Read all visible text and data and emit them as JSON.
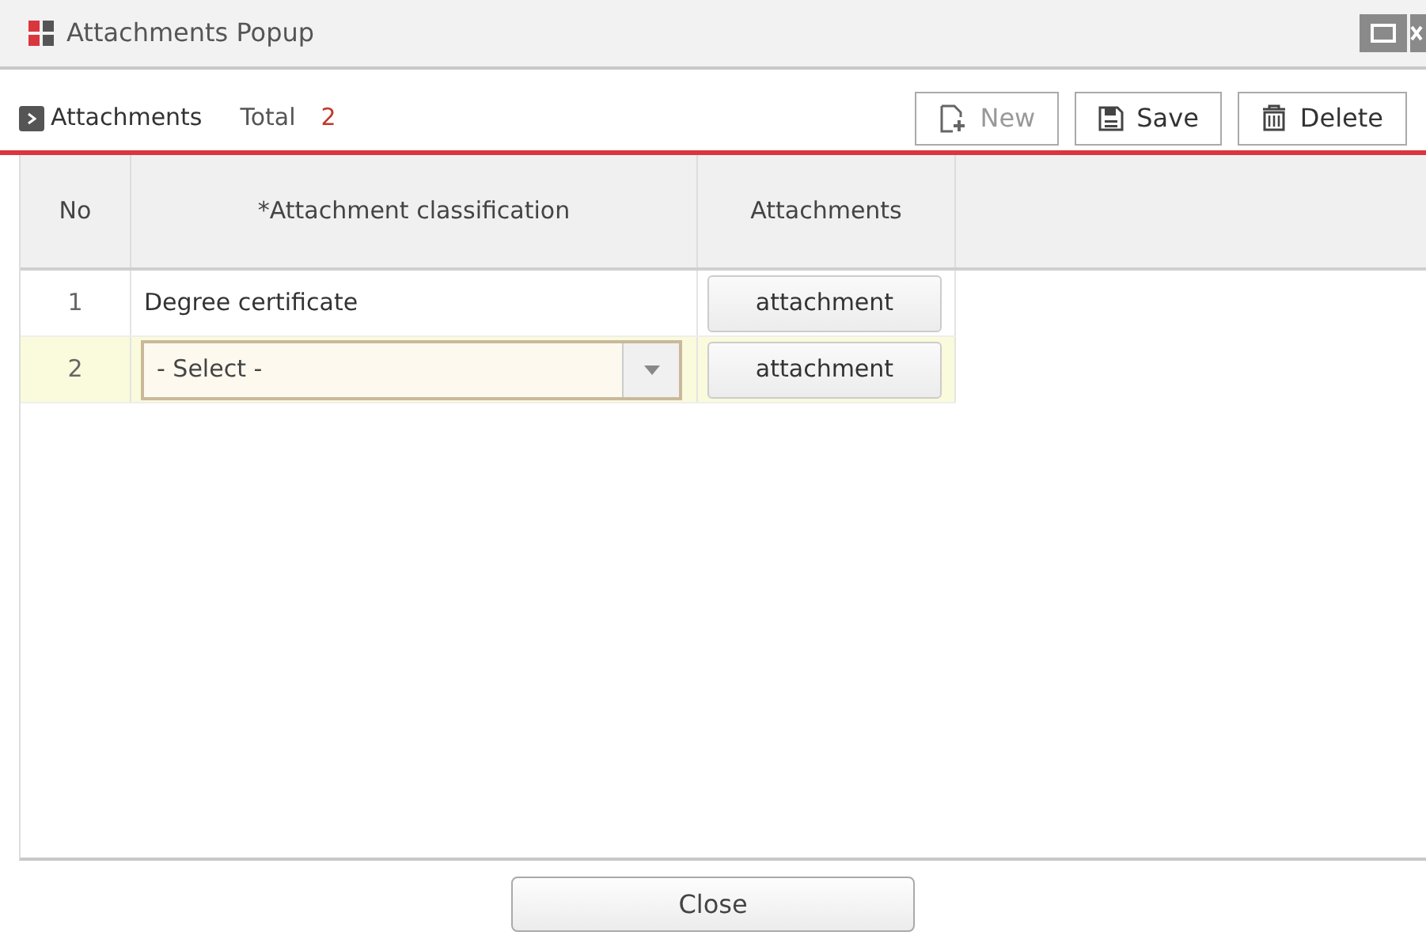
{
  "window": {
    "title": "Attachments Popup"
  },
  "toolbar": {
    "section": "Attachments",
    "total_label": "Total",
    "total": "2",
    "buttons": [
      {
        "kind": "new",
        "label": "New",
        "disabled": true
      },
      {
        "kind": "save",
        "label": "Save",
        "disabled": false
      },
      {
        "kind": "delete",
        "label": "Delete",
        "disabled": false
      }
    ]
  },
  "table": {
    "columns": [
      "No",
      "*Attachment classification",
      "Attachments"
    ],
    "rows": [
      {
        "no": "1",
        "kind": "text",
        "classification": "Degree certificate",
        "attachment": "attachment",
        "selected": false
      },
      {
        "no": "2",
        "kind": "select",
        "classification": "- Select -",
        "attachment": "attachment",
        "selected": true
      }
    ]
  },
  "footer": {
    "button": "Close"
  }
}
